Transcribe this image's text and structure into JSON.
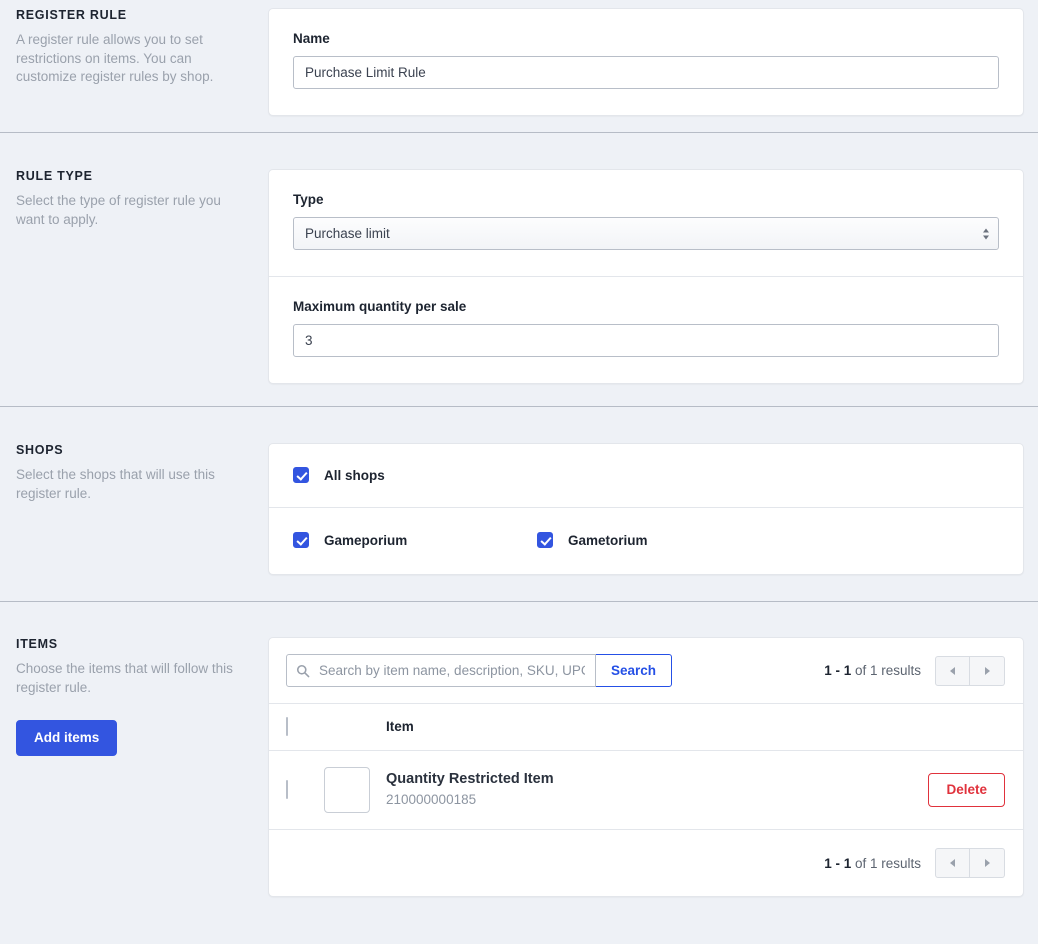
{
  "sections": {
    "register_rule": {
      "title": "REGISTER RULE",
      "description": "A register rule allows you to set restrictions on items. You can customize register rules by shop.",
      "name_label": "Name",
      "name_value": "Purchase Limit Rule",
      "name_placeholder": ""
    },
    "rule_type": {
      "title": "RULE TYPE",
      "description": "Select the type of register rule you want to apply.",
      "type_label": "Type",
      "type_value": "Purchase limit",
      "type_options": [
        "Purchase limit"
      ],
      "max_qty_label": "Maximum quantity per sale",
      "max_qty_value": "3",
      "max_qty_placeholder": ""
    },
    "shops": {
      "title": "SHOPS",
      "description": "Select the shops that will use this register rule.",
      "all_shops_label": "All shops",
      "all_shops_checked": true,
      "list": [
        {
          "label": "Gameporium",
          "checked": true
        },
        {
          "label": "Gametorium",
          "checked": true
        }
      ]
    },
    "items": {
      "title": "ITEMS",
      "description": "Choose the items that will follow this register rule.",
      "add_items_label": "Add items",
      "search_placeholder": "Search by item name, description, SKU, UPC",
      "search_value": "",
      "search_button_label": "Search",
      "search_icon": "search-icon",
      "pagination": {
        "range": "1 - 1",
        "suffix": "of 1 results",
        "prev_icon": "chevron-left-icon",
        "next_icon": "chevron-right-icon"
      },
      "columns": [
        "",
        "",
        "Item",
        ""
      ],
      "header_item_label": "Item",
      "select_all_checked": false,
      "rows": [
        {
          "checked": false,
          "thumbnail": "image-placeholder",
          "name": "Quantity Restricted Item",
          "sku": "210000000185",
          "action_label": "Delete"
        }
      ]
    }
  },
  "colors": {
    "accent": "#3355e0",
    "link": "#2550e6",
    "danger": "#e0323c",
    "page_bg": "#eef1f6",
    "card_bg": "#ffffff",
    "border": "#e3e6eb",
    "muted_text": "#9aa1ac",
    "heading_text": "#1d2430"
  }
}
